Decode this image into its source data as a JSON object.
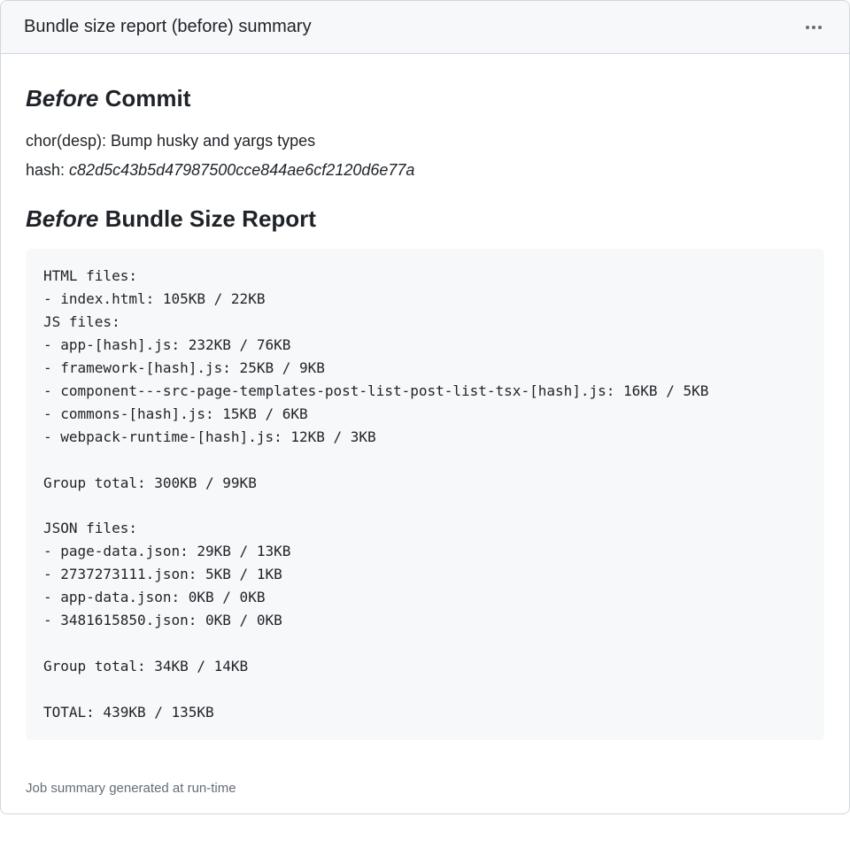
{
  "header": {
    "title": "Bundle size report (before) summary"
  },
  "section1": {
    "heading_em": "Before",
    "heading_rest": " Commit",
    "commit_message": "chor(desp): Bump husky and yargs types",
    "hash_label": "hash: ",
    "hash_value": "c82d5c43b5d47987500cce844ae6cf2120d6e77a"
  },
  "section2": {
    "heading_em": "Before",
    "heading_rest": " Bundle Size Report"
  },
  "report": {
    "html_files_header": "HTML files:",
    "html_files": [
      "- index.html: 105KB / 22KB"
    ],
    "js_files_header": "JS files:",
    "js_files": [
      "- app-[hash].js: 232KB / 76KB",
      "- framework-[hash].js: 25KB / 9KB",
      "- component---src-page-templates-post-list-post-list-tsx-[hash].js: 16KB / 5KB",
      "- commons-[hash].js: 15KB / 6KB",
      "- webpack-runtime-[hash].js: 12KB / 3KB"
    ],
    "group_total_1": "Group total: 300KB / 99KB",
    "json_files_header": "JSON files:",
    "json_files": [
      "- page-data.json: 29KB / 13KB",
      "- 2737273111.json: 5KB / 1KB",
      "- app-data.json: 0KB / 0KB",
      "- 3481615850.json: 0KB / 0KB"
    ],
    "group_total_2": "Group total: 34KB / 14KB",
    "total": "TOTAL: 439KB / 135KB"
  },
  "footer": {
    "text": "Job summary generated at run-time"
  }
}
